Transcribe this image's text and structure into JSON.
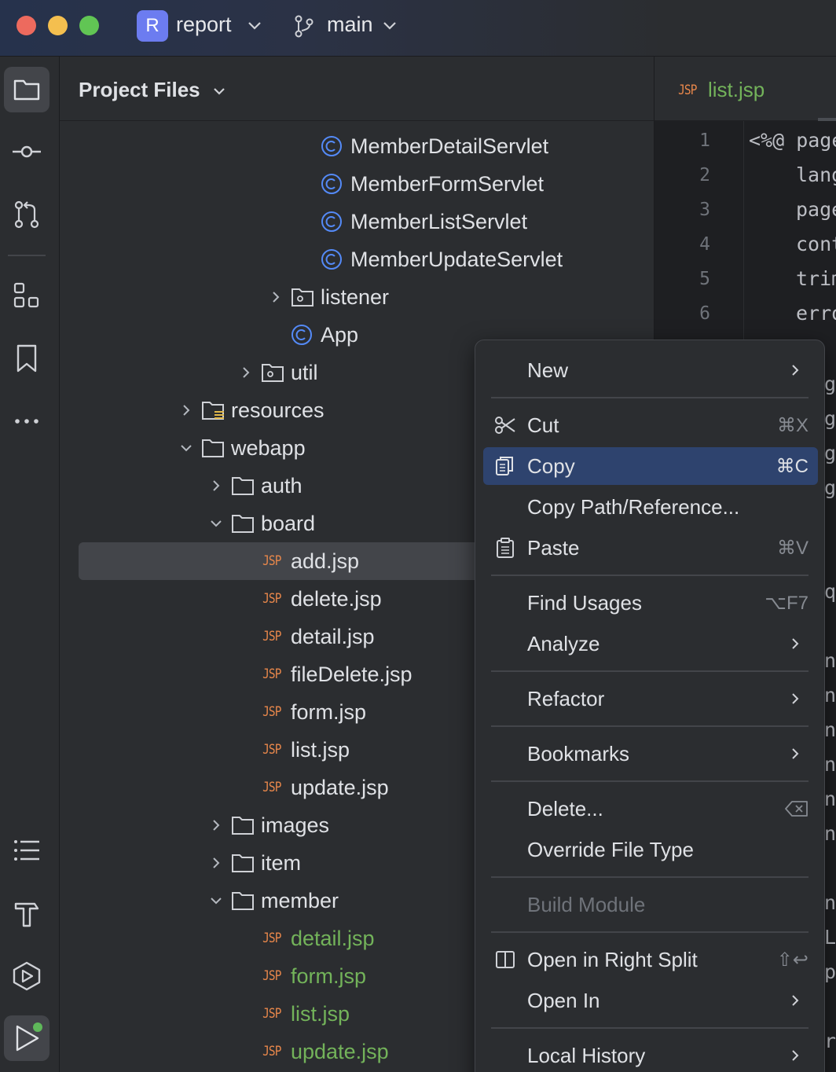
{
  "titlebar": {
    "project_badge": "R",
    "project_name": "report",
    "branch_name": "main"
  },
  "toolstrip": {
    "icons": [
      "project-folder-icon",
      "commit-icon",
      "pull-requests-icon",
      "structure-icon",
      "bookmarks-icon",
      "more-icon",
      "todo-list-icon",
      "build-hammer-icon",
      "services-icon",
      "run-icon"
    ]
  },
  "project_panel": {
    "title": "Project Files",
    "tree": [
      {
        "label": "MemberDetailServlet",
        "kind": "class"
      },
      {
        "label": "MemberFormServlet",
        "kind": "class"
      },
      {
        "label": "MemberListServlet",
        "kind": "class"
      },
      {
        "label": "MemberUpdateServlet",
        "kind": "class"
      },
      {
        "label": "listener",
        "kind": "package",
        "expanded": false
      },
      {
        "label": "App",
        "kind": "class"
      },
      {
        "label": "util",
        "kind": "package",
        "expanded": false
      },
      {
        "label": "resources",
        "kind": "resources-folder",
        "expanded": false
      },
      {
        "label": "webapp",
        "kind": "folder",
        "expanded": true
      },
      {
        "label": "auth",
        "kind": "folder",
        "expanded": false
      },
      {
        "label": "board",
        "kind": "folder",
        "expanded": true
      },
      {
        "label": "add.jsp",
        "kind": "jsp",
        "selected": true
      },
      {
        "label": "delete.jsp",
        "kind": "jsp"
      },
      {
        "label": "detail.jsp",
        "kind": "jsp"
      },
      {
        "label": "fileDelete.jsp",
        "kind": "jsp"
      },
      {
        "label": "form.jsp",
        "kind": "jsp"
      },
      {
        "label": "list.jsp",
        "kind": "jsp"
      },
      {
        "label": "update.jsp",
        "kind": "jsp"
      },
      {
        "label": "images",
        "kind": "folder",
        "expanded": false
      },
      {
        "label": "item",
        "kind": "folder",
        "expanded": false
      },
      {
        "label": "member",
        "kind": "folder",
        "expanded": true
      },
      {
        "label": "detail.jsp",
        "kind": "jsp",
        "modified": true
      },
      {
        "label": "form.jsp",
        "kind": "jsp",
        "modified": true
      },
      {
        "label": "list.jsp",
        "kind": "jsp",
        "modified": true
      },
      {
        "label": "update.jsp",
        "kind": "jsp",
        "modified": true
      }
    ],
    "jsp_badge": "JSP"
  },
  "editor": {
    "tab_label": "list.jsp",
    "tab_badge": "JSP",
    "line_numbers": [
      "1",
      "2",
      "3",
      "4",
      "5",
      "6"
    ],
    "code_lines": [
      "<%@ page",
      "lang",
      "page",
      "cont",
      "trim",
      "erro"
    ],
    "partial_right_glyphs": [
      "ge",
      "ge",
      "ge",
      "ge",
      "qu",
      "nb",
      "nb",
      "nb",
      "nb",
      "nb",
      "nb",
      "nb",
      "LS",
      "pC",
      "rt"
    ]
  },
  "context_menu": {
    "items": [
      {
        "label": "New",
        "submenu": true
      },
      {
        "label": "Cut",
        "shortcut": "⌘X",
        "icon": "scissors-icon"
      },
      {
        "label": "Copy",
        "shortcut": "⌘C",
        "icon": "copy-icon",
        "highlighted": true
      },
      {
        "label": "Copy Path/Reference..."
      },
      {
        "label": "Paste",
        "shortcut": "⌘V",
        "icon": "paste-icon"
      },
      {
        "label": "Find Usages",
        "shortcut": "⌥F7"
      },
      {
        "label": "Analyze",
        "submenu": true
      },
      {
        "label": "Refactor",
        "submenu": true
      },
      {
        "label": "Bookmarks",
        "submenu": true
      },
      {
        "label": "Delete...",
        "shortcut_icon": "delete-key-icon"
      },
      {
        "label": "Override File Type"
      },
      {
        "label": "Build Module",
        "disabled": true
      },
      {
        "label": "Open in Right Split",
        "shortcut": "⇧↩",
        "icon": "split-right-icon"
      },
      {
        "label": "Open In",
        "submenu": true
      },
      {
        "label": "Local History",
        "submenu": true
      }
    ]
  },
  "colors": {
    "accent_highlight": "#2e436e",
    "modified_file": "#73b35a",
    "jsp_badge": "#e8874b",
    "class_icon": "#548af7"
  }
}
